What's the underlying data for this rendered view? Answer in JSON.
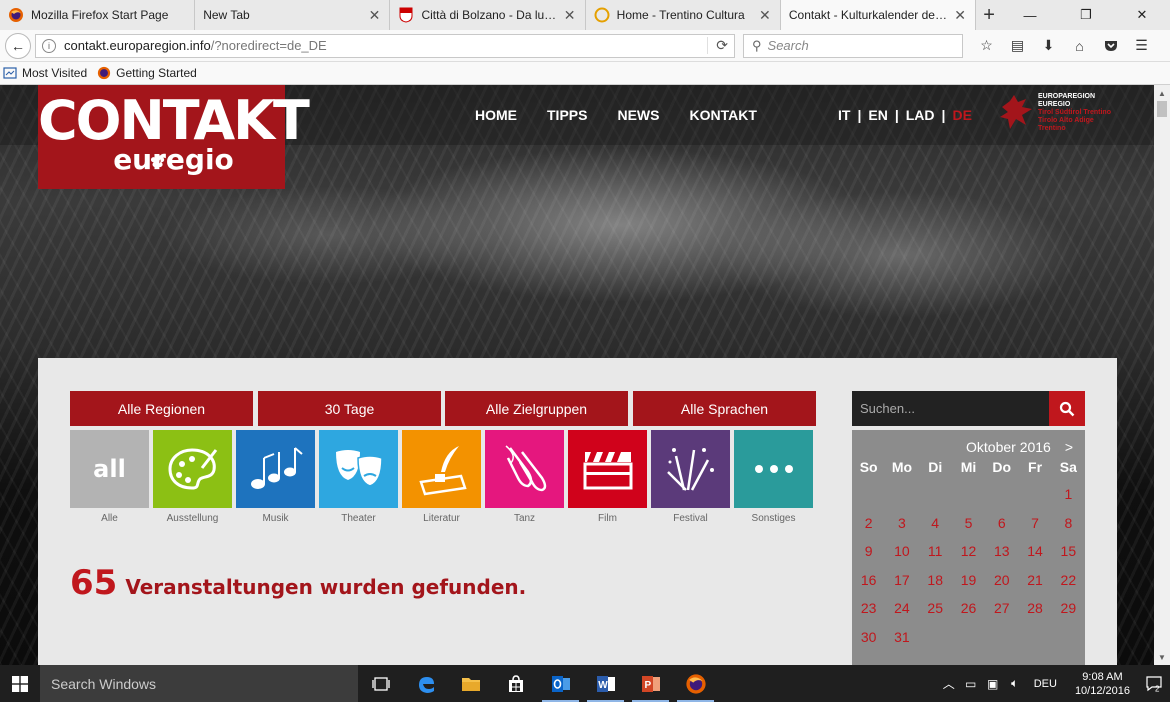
{
  "browser": {
    "tabs": [
      {
        "title": "Mozilla Firefox Start Page",
        "icon": "firefox-icon"
      },
      {
        "title": "New Tab",
        "icon": ""
      },
      {
        "title": "Città di Bolzano - Da lune...",
        "icon": "bolzano-crest-icon"
      },
      {
        "title": "Home - Trentino Cultura",
        "icon": "trentino-icon"
      },
      {
        "title": "Contakt - Kulturkalender der E...",
        "icon": ""
      }
    ],
    "url_host": "contakt.europaregion.info",
    "url_path": "/?noredirect=de_DE",
    "search_placeholder": "Search",
    "bookmarks": [
      "Most Visited",
      "Getting Started"
    ]
  },
  "site": {
    "logo_big": "CONTAKT",
    "logo_small": "euregio",
    "nav": [
      "HOME",
      "TIPPS",
      "NEWS",
      "KONTAKT"
    ],
    "languages": [
      "IT",
      "EN",
      "LAD",
      "DE"
    ],
    "current_language": "DE",
    "euregio_text": [
      "EUROPAREGION",
      "EUREGIO",
      "Tirol Südtirol Trentino",
      "Tirolo Alto Adige Trentino"
    ],
    "filters": [
      "Alle Regionen",
      "30 Tage",
      "Alle Zielgruppen",
      "Alle Sprachen"
    ],
    "categories": [
      {
        "label": "Alle",
        "icon": "all-icon",
        "color": "#b3b3b3",
        "tile_text": "all"
      },
      {
        "label": "Ausstellung",
        "icon": "palette-icon",
        "color": "#8cc014"
      },
      {
        "label": "Musik",
        "icon": "music-notes-icon",
        "color": "#1e73be"
      },
      {
        "label": "Theater",
        "icon": "theater-masks-icon",
        "color": "#2ea7e0"
      },
      {
        "label": "Literatur",
        "icon": "quill-ink-icon",
        "color": "#f39200"
      },
      {
        "label": "Tanz",
        "icon": "ballet-shoes-icon",
        "color": "#e5177e"
      },
      {
        "label": "Film",
        "icon": "clapperboard-icon",
        "color": "#d0021b"
      },
      {
        "label": "Festival",
        "icon": "fireworks-icon",
        "color": "#5b3a7a"
      },
      {
        "label": "Sonstiges",
        "icon": "more-dots-icon",
        "color": "#2a9b9b"
      }
    ],
    "result_count": "65",
    "result_text": "Veranstaltungen wurden gefunden.",
    "search_placeholder": "Suchen...",
    "calendar": {
      "month": "Oktober 2016",
      "next": ">",
      "weekdays": [
        "So",
        "Mo",
        "Di",
        "Mi",
        "Do",
        "Fr",
        "Sa"
      ],
      "weeks": [
        [
          "",
          "",
          "",
          "",
          "",
          "",
          "1"
        ],
        [
          "2",
          "3",
          "4",
          "5",
          "6",
          "7",
          "8"
        ],
        [
          "9",
          "10",
          "11",
          "12",
          "13",
          "14",
          "15"
        ],
        [
          "16",
          "17",
          "18",
          "19",
          "20",
          "21",
          "22"
        ],
        [
          "23",
          "24",
          "25",
          "26",
          "27",
          "28",
          "29"
        ],
        [
          "30",
          "31",
          "",
          "",
          "",
          "",
          ""
        ]
      ]
    }
  },
  "taskbar": {
    "search_text": "Search Windows",
    "language": "DEU",
    "time": "9:08 AM",
    "date": "10/12/2016",
    "notifications": "2"
  },
  "colors": {
    "brand_red": "#a3151b",
    "accent_red": "#c0171d"
  }
}
